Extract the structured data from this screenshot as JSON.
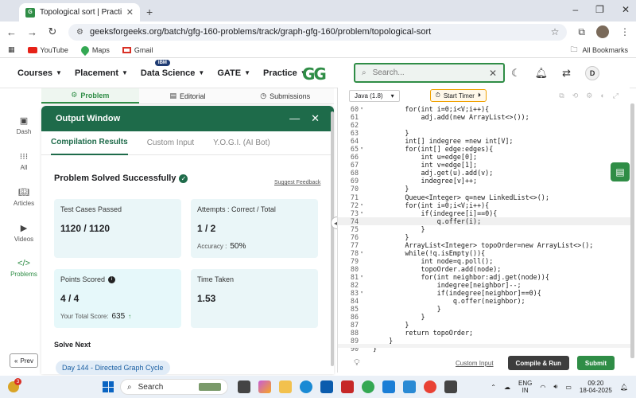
{
  "browser": {
    "tab_title": "Topological sort | Practice | Gee",
    "url": "geeksforgeeks.org/batch/gfg-160-problems/track/graph-gfg-160/problem/topological-sort",
    "bookmarks": [
      "YouTube",
      "Maps",
      "Gmail"
    ],
    "all_bookmarks": "All Bookmarks"
  },
  "header": {
    "menu": [
      "Courses",
      "Placement",
      "Data Science",
      "GATE",
      "Practice"
    ],
    "ibm_badge": "IBM",
    "logo": "GG",
    "search_placeholder": "Search...",
    "avatar": "D"
  },
  "sidebar": {
    "items": [
      "Dash",
      "All",
      "Articles",
      "Videos",
      "Problems"
    ],
    "prev": "Prev"
  },
  "problem_tabs": [
    "Problem",
    "Editorial",
    "Submissions"
  ],
  "output": {
    "title": "Output Window",
    "tabs": [
      "Compilation Results",
      "Custom Input",
      "Y.O.G.I. (AI Bot)"
    ],
    "status": "Problem Solved Successfully",
    "suggest": "Suggest Feedback",
    "test_cases_label": "Test Cases Passed",
    "test_cases_value": "1120 / 1120",
    "attempts_label": "Attempts : Correct / Total",
    "attempts_value": "1 / 2",
    "accuracy_label": "Accuracy :",
    "accuracy_value": "50%",
    "points_label": "Points Scored",
    "points_value": "4 / 4",
    "total_score_label": "Your Total Score:",
    "total_score_value": "635",
    "time_label": "Time Taken",
    "time_value": "1.53",
    "solve_next": "Solve Next",
    "next_problem": "Day 144 - Directed Graph Cycle"
  },
  "editor": {
    "language": "Java (1.8)",
    "timer": "Start Timer",
    "lines": [
      {
        "n": "60",
        "t": "        for(int i=0;i<V;i++){",
        "fold": true
      },
      {
        "n": "61",
        "t": "            adj.add(new ArrayList<>());"
      },
      {
        "n": "62",
        "t": ""
      },
      {
        "n": "63",
        "t": "        }"
      },
      {
        "n": "64",
        "t": "        int[] indegree =new int[V];"
      },
      {
        "n": "65",
        "t": "        for(int[] edge:edges){",
        "fold": true
      },
      {
        "n": "66",
        "t": "            int u=edge[0];"
      },
      {
        "n": "67",
        "t": "            int v=edge[1];"
      },
      {
        "n": "68",
        "t": "            adj.get(u).add(v);"
      },
      {
        "n": "69",
        "t": "            indegree[v]++;"
      },
      {
        "n": "70",
        "t": "        }"
      },
      {
        "n": "71",
        "t": "        Queue<Integer> q=new LinkedList<>();"
      },
      {
        "n": "72",
        "t": "        for(int i=0;i<V;i++){",
        "fold": true
      },
      {
        "n": "73",
        "t": "            if(indegree[i]==0){",
        "fold": true
      },
      {
        "n": "74",
        "t": "                q.offer(i);",
        "cur": true
      },
      {
        "n": "75",
        "t": "            }"
      },
      {
        "n": "76",
        "t": "        }"
      },
      {
        "n": "77",
        "t": "        ArrayList<Integer> topoOrder=new ArrayList<>();"
      },
      {
        "n": "78",
        "t": "        while(!q.isEmpty()){",
        "fold": true
      },
      {
        "n": "79",
        "t": "            int node=q.poll();"
      },
      {
        "n": "80",
        "t": "            topoOrder.add(node);"
      },
      {
        "n": "81",
        "t": "            for(int neighbor:adj.get(node)){",
        "fold": true
      },
      {
        "n": "82",
        "t": "                indegree[neighbor]--;"
      },
      {
        "n": "83",
        "t": "                if(indegree[neighbor]==0){",
        "fold": true
      },
      {
        "n": "84",
        "t": "                    q.offer(neighbor);"
      },
      {
        "n": "85",
        "t": "                }"
      },
      {
        "n": "86",
        "t": "            }"
      },
      {
        "n": "87",
        "t": "        }"
      },
      {
        "n": "88",
        "t": "        return topoOrder;"
      },
      {
        "n": "89",
        "t": "    }"
      },
      {
        "n": "90",
        "t": "}"
      }
    ],
    "custom_input": "Custom Input",
    "compile": "Compile & Run",
    "submit": "Submit"
  },
  "taskbar": {
    "search": "Search",
    "weather_badge": "3",
    "lang_top": "ENG",
    "lang_bottom": "IN",
    "time": "09:20",
    "date": "18-04-2025"
  }
}
